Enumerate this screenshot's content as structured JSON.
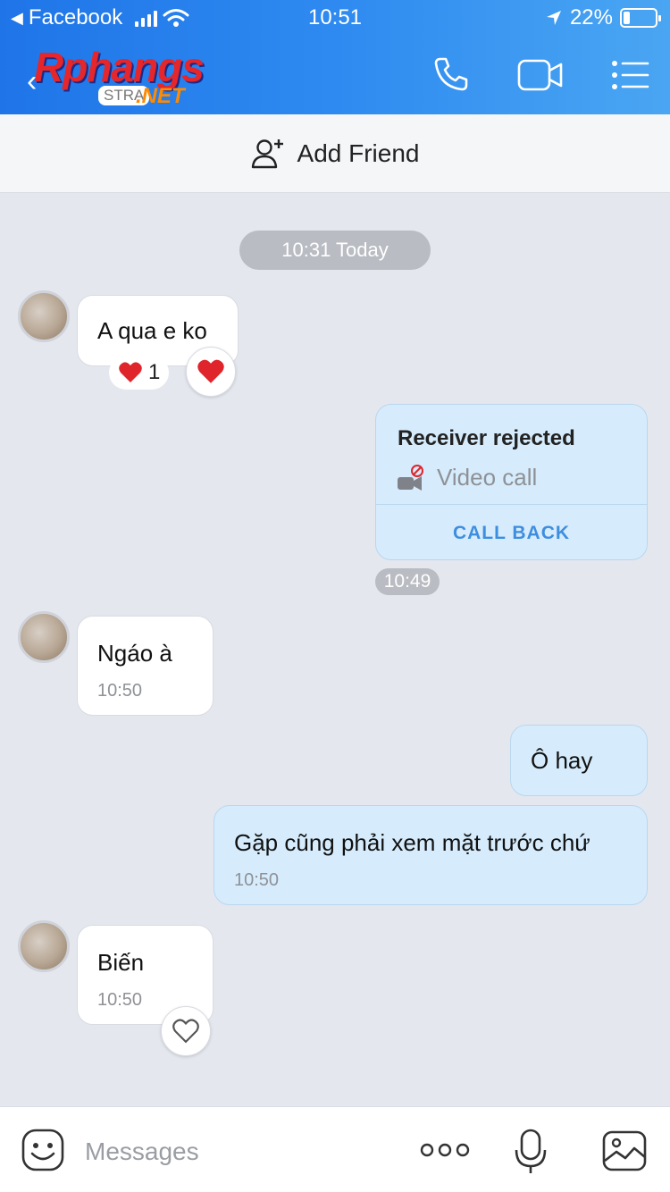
{
  "status_bar": {
    "back_app": "Facebook",
    "time": "10:51",
    "battery": "22%",
    "battery_level": 0.22
  },
  "header": {
    "logo_text": "Rphangs",
    "logo_sub_left": "STRA",
    "logo_sub_right": ".NET",
    "icons": [
      "back-chevron-icon",
      "phone-icon",
      "video-camera-icon",
      "menu-list-icon"
    ]
  },
  "add_friend": {
    "label": "Add Friend"
  },
  "chat": {
    "day_label": "10:31 Today",
    "messages": {
      "m1": {
        "text": "A qua e ko",
        "reaction_count": "1"
      },
      "call": {
        "title": "Receiver rejected",
        "type": "Video call",
        "action": "CALL BACK",
        "time": "10:49"
      },
      "m2": {
        "text": "Ngáo à",
        "time": "10:50"
      },
      "m3": {
        "text": "Ô hay"
      },
      "m4": {
        "text": "Gặp cũng phải xem mặt trước chứ",
        "time": "10:50"
      },
      "m5": {
        "text": "Biến",
        "time": "10:50"
      }
    }
  },
  "input": {
    "placeholder": "Messages"
  },
  "colors": {
    "header_blue": "#2e8af0",
    "outgoing_bubble": "#d6ecfc",
    "incoming_bubble": "#ffffff",
    "chat_bg": "#e4e7ee",
    "heart": "#e0242b",
    "link_blue": "#3e8ee0"
  }
}
